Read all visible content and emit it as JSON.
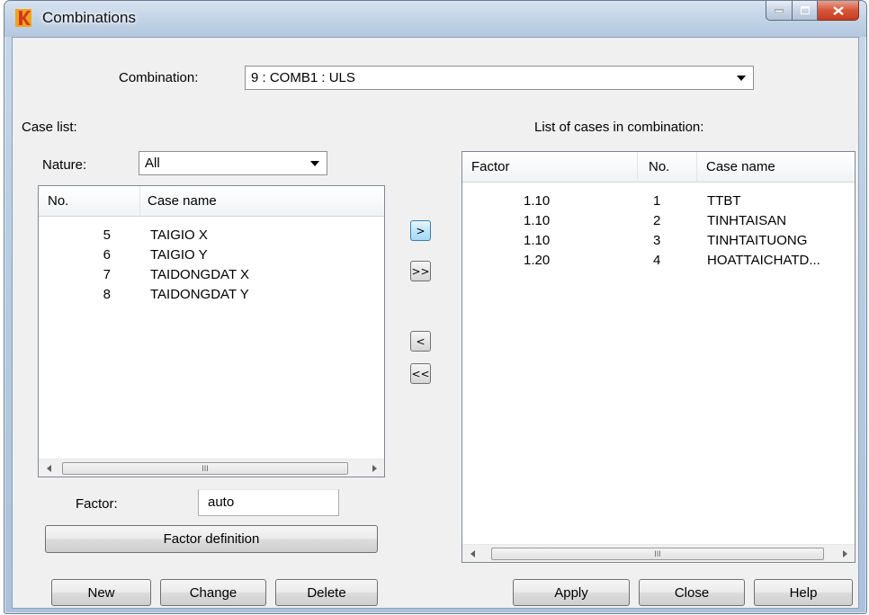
{
  "window": {
    "title": "Combinations",
    "icon": "robot-app-icon"
  },
  "combination": {
    "label": "Combination:",
    "value": "9 : COMB1 : ULS"
  },
  "case_list": {
    "label": "Case list:",
    "nature_label": "Nature:",
    "nature_value": "All",
    "columns": [
      "No.",
      "Case name"
    ],
    "rows": [
      {
        "no": "5",
        "name": "TAIGIO X"
      },
      {
        "no": "6",
        "name": "TAIGIO Y"
      },
      {
        "no": "7",
        "name": "TAIDONGDAT X"
      },
      {
        "no": "8",
        "name": "TAIDONGDAT Y"
      }
    ],
    "scroll_grip": "III"
  },
  "combination_cases": {
    "label": "List of cases in combination:",
    "columns": [
      "Factor",
      "No.",
      "Case name"
    ],
    "rows": [
      {
        "factor": "1.10",
        "no": "1",
        "name": "TTBT"
      },
      {
        "factor": "1.10",
        "no": "2",
        "name": "TINHTAISAN"
      },
      {
        "factor": "1.10",
        "no": "3",
        "name": "TINHTAITUONG"
      },
      {
        "factor": "1.20",
        "no": "4",
        "name": "HOATTAICHATD..."
      }
    ],
    "scroll_grip": "III"
  },
  "transfer": {
    "add": ">",
    "add_all": ">>",
    "remove": "<",
    "remove_all": "<<"
  },
  "factor": {
    "label": "Factor:",
    "value": "auto",
    "definition_button": "Factor definition"
  },
  "buttons": {
    "new": "New",
    "change": "Change",
    "delete": "Delete",
    "apply": "Apply",
    "close": "Close",
    "help": "Help"
  },
  "colors": {
    "close_button": "#c9452a",
    "selected_arrow_button": "#bee6fd",
    "dialog_bg": "#f0f0f0"
  }
}
